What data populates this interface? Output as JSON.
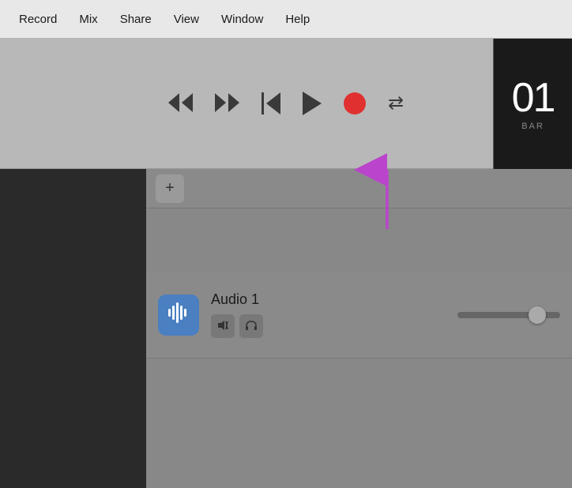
{
  "menubar": {
    "items": [
      {
        "label": "Record",
        "id": "record"
      },
      {
        "label": "Mix",
        "id": "mix"
      },
      {
        "label": "Share",
        "id": "share"
      },
      {
        "label": "View",
        "id": "view"
      },
      {
        "label": "Window",
        "id": "window"
      },
      {
        "label": "Help",
        "id": "help"
      }
    ]
  },
  "transport": {
    "display": {
      "number": "01",
      "label": "BAR"
    },
    "buttons": {
      "rewind": "⏪",
      "fastforward": "⏩",
      "skipstart": "⏮",
      "play": "▶",
      "record": "●",
      "loop": "🔁"
    }
  },
  "add_button_label": "+",
  "track": {
    "name": "Audio 1",
    "icon": "🎵",
    "mute_label": "🔇",
    "headphone_label": "🎧"
  }
}
